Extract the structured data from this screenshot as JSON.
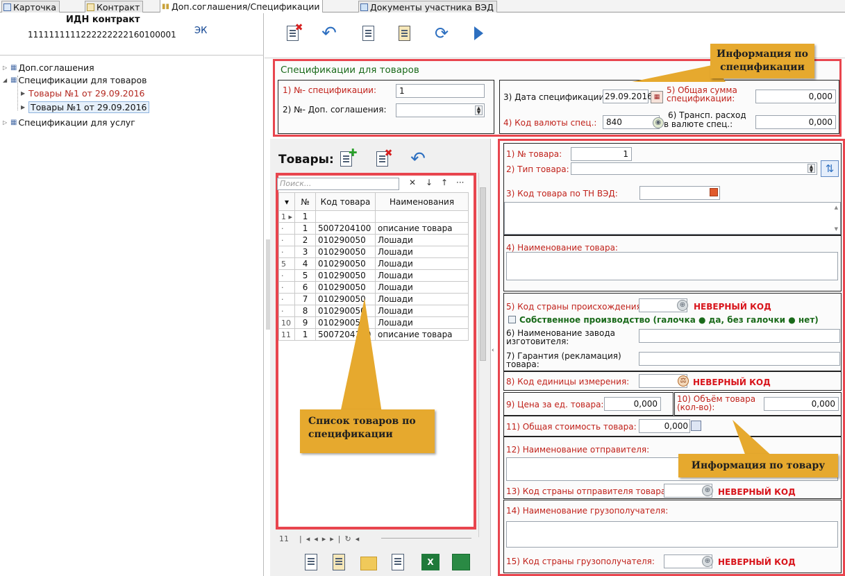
{
  "tabs": [
    {
      "label": "Карточка",
      "active": false
    },
    {
      "label": "Контракт",
      "active": false
    },
    {
      "label": "Доп.соглашения/Спецификации",
      "active": true
    },
    {
      "label": "Документы участника ВЭД",
      "active": false
    }
  ],
  "left": {
    "idn_title": "ИДН контракт",
    "idn_value": "1111111111222222222160100001",
    "idn_badge": "ЭК",
    "tree": [
      "Доп.соглашения",
      "Спецификации для товаров",
      "Товары №1 от 29.09.2016",
      "Товары №1 от 29.09.2016",
      "Спецификации для услуг"
    ]
  },
  "spec": {
    "title": "Спецификации для товаров",
    "num_label": "1) №- спецификации:",
    "num_value": "1",
    "addendum_label": "2) №- Доп. соглашения:",
    "addendum_value": "",
    "date_label": "3) Дата спецификации:",
    "date_value": "29.09.2016",
    "currency_label": "4) Код валюты спец.:",
    "currency_value": "840",
    "sum_label_1": "5) Общая сумма",
    "sum_label_2": "спецификации:",
    "sum_value": "0,000",
    "transport_label_1": "6) Трансп. расход",
    "transport_label_2": "в валюте спец.:",
    "transport_value": "0,000"
  },
  "goods": {
    "title": "Товары:",
    "search_placeholder": "Поиск...",
    "col_no": "№",
    "col_code": "Код товара",
    "col_name": "Наименования",
    "rows": [
      {
        "ind": "1 ▸",
        "no": "1",
        "code": "",
        "name": ""
      },
      {
        "ind": "·",
        "no": "1",
        "code": "5007204100",
        "name": "описание товара"
      },
      {
        "ind": "·",
        "no": "2",
        "code": "010290050",
        "name": "Лошади"
      },
      {
        "ind": "·",
        "no": "3",
        "code": "010290050",
        "name": "Лошади"
      },
      {
        "ind": "5",
        "no": "4",
        "code": "010290050",
        "name": "Лошади"
      },
      {
        "ind": "·",
        "no": "5",
        "code": "010290050",
        "name": "Лошади"
      },
      {
        "ind": "·",
        "no": "6",
        "code": "010290050",
        "name": "Лошади"
      },
      {
        "ind": "·",
        "no": "7",
        "code": "010290050",
        "name": "Лошади"
      },
      {
        "ind": "·",
        "no": "8",
        "code": "010290050",
        "name": "Лошади"
      },
      {
        "ind": "10",
        "no": "9",
        "code": "010290050",
        "name": "Лошади"
      },
      {
        "ind": "11",
        "no": "1",
        "code": "5007204100",
        "name": "описание товара"
      }
    ],
    "nav_count": "11"
  },
  "item": {
    "no_label": "1) № товара:",
    "no_value": "1",
    "type_label": "2) Тип товара:",
    "type_value": "",
    "hs_label": "3) Код товара по ТН ВЭД:",
    "hs_value": "",
    "name_label": "4) Наименование товара:",
    "origin_label": "5) Код страны происхождения:",
    "invalid_code": "НЕВЕРНЫЙ КОД",
    "own_production": "Собственное производство (галочка ● да, без галочки ● нет)",
    "factory_label_1": "6) Наименование завода",
    "factory_label_2": "изготовителя:",
    "warranty_label_1": "7) Гарантия (рекламация)",
    "warranty_label_2": "товара:",
    "unit_label": "8) Код единицы измерения:",
    "price_label": "9) Цена за ед. товара:",
    "price_value": "0,000",
    "volume_label_1": "10) Объём товара",
    "volume_label_2": "(кол-во):",
    "volume_value": "0,000",
    "total_label": "11) Общая стоимость товара:",
    "total_value": "0,000",
    "sender_label": "12) Наименование отправителя:",
    "sender_country_label": "13) Код страны отправителя товара:",
    "consignee_label": "14) Наименование грузополучателя:",
    "consignee_country_label": "15) Код страны грузополучателя:"
  },
  "callouts": {
    "spec_info_1": "Информация по",
    "spec_info_2": "спецификации",
    "goods_list_1": "Список товаров по",
    "goods_list_2": "спецификации",
    "item_info": "Информация по товару"
  },
  "colors": {
    "highlight": "#e8454e",
    "callout": "#e6a92e",
    "invalid": "#d8141b",
    "required_label": "#c0211a"
  }
}
